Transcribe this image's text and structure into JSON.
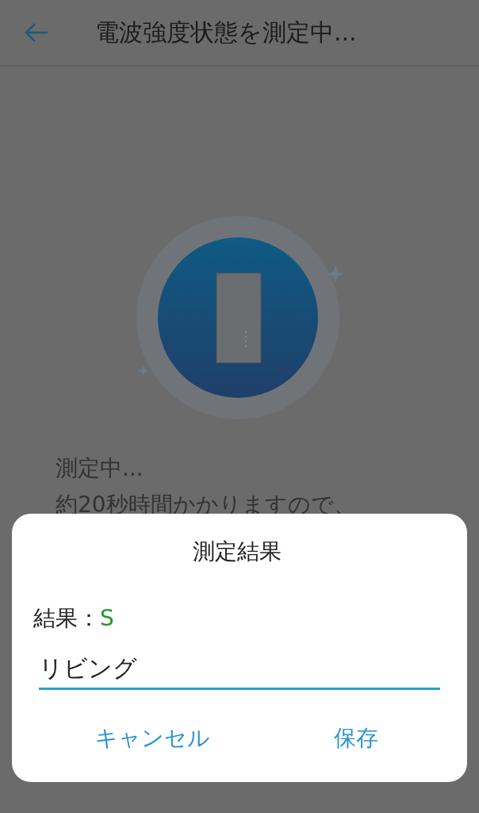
{
  "app_bar": {
    "title": "電波強度状態を測定中..."
  },
  "status": {
    "lines": [
      "測定中...",
      "約20秒時間かかりますので、"
    ]
  },
  "dialog": {
    "title": "測定結果",
    "result_label": "結果：",
    "result_value": "S",
    "name_field": {
      "value": "リビング"
    },
    "buttons": [
      {
        "label": "キャンセル"
      },
      {
        "label": "保存"
      }
    ]
  }
}
